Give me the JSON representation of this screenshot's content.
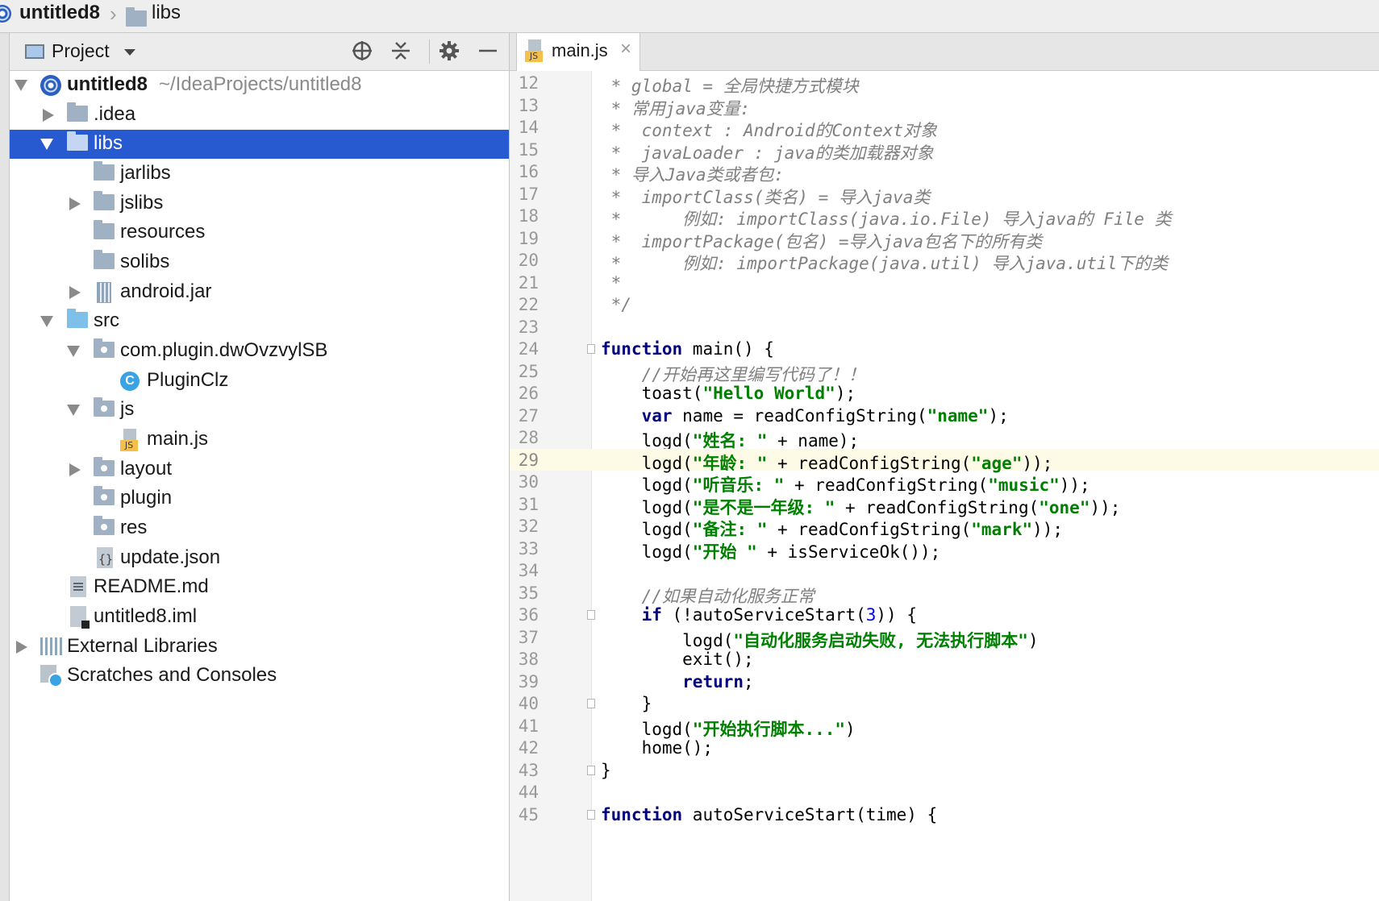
{
  "breadcrumb": {
    "project": "untitled8",
    "folder": "libs"
  },
  "project_panel": {
    "title": "Project",
    "tools": [
      "locate-icon",
      "collapse-icon",
      "gear-icon",
      "minimize-icon"
    ]
  },
  "tree": [
    {
      "label": "untitled8",
      "path": "~/IdeaProjects/untitled8"
    },
    {
      "label": ".idea"
    },
    {
      "label": "libs"
    },
    {
      "label": "jarlibs"
    },
    {
      "label": "jslibs"
    },
    {
      "label": "resources"
    },
    {
      "label": "solibs"
    },
    {
      "label": "android.jar"
    },
    {
      "label": "src"
    },
    {
      "label": "com.plugin.dwOvzvylSB"
    },
    {
      "label": "PluginClz"
    },
    {
      "label": "js"
    },
    {
      "label": "main.js"
    },
    {
      "label": "layout"
    },
    {
      "label": "plugin"
    },
    {
      "label": "res"
    },
    {
      "label": "update.json"
    },
    {
      "label": "README.md"
    },
    {
      "label": "untitled8.iml"
    },
    {
      "label": "External Libraries"
    },
    {
      "label": "Scratches and Consoles"
    }
  ],
  "editor": {
    "tab_label": "main.js",
    "current_line": "29",
    "lines": [
      {
        "n": "12",
        "t": [
          [
            "c",
            " * global = 全局快捷方式模块"
          ]
        ]
      },
      {
        "n": "13",
        "t": [
          [
            "c",
            " * 常用java变量:"
          ]
        ]
      },
      {
        "n": "14",
        "t": [
          [
            "c",
            " *  context : Android的Context对象"
          ]
        ]
      },
      {
        "n": "15",
        "t": [
          [
            "c",
            " *  javaLoader : java的类加载器对象"
          ]
        ]
      },
      {
        "n": "16",
        "t": [
          [
            "c",
            " * 导入Java类或者包:"
          ]
        ]
      },
      {
        "n": "17",
        "t": [
          [
            "c",
            " *  importClass(类名) = 导入java类"
          ]
        ]
      },
      {
        "n": "18",
        "t": [
          [
            "c",
            " *      例如: importClass(java.io.File) 导入java的 File 类"
          ]
        ]
      },
      {
        "n": "19",
        "t": [
          [
            "c",
            " *  importPackage(包名) =导入java包名下的所有类"
          ]
        ]
      },
      {
        "n": "20",
        "t": [
          [
            "c",
            " *      例如: importPackage(java.util) 导入java.util下的类"
          ]
        ]
      },
      {
        "n": "21",
        "t": [
          [
            "c",
            " *"
          ]
        ]
      },
      {
        "n": "22",
        "t": [
          [
            "c",
            " */"
          ]
        ]
      },
      {
        "n": "23",
        "t": []
      },
      {
        "n": "24",
        "t": [
          [
            "k",
            "function"
          ],
          [
            "p",
            " main() {"
          ]
        ]
      },
      {
        "n": "25",
        "t": [
          [
            "p",
            "    "
          ],
          [
            "c2",
            "//开始再这里编写代码了！！"
          ]
        ]
      },
      {
        "n": "26",
        "t": [
          [
            "p",
            "    toast("
          ],
          [
            "s",
            "\"Hello World\""
          ],
          [
            "p",
            ");"
          ]
        ]
      },
      {
        "n": "27",
        "t": [
          [
            "p",
            "    "
          ],
          [
            "k",
            "var"
          ],
          [
            "p",
            " name = readConfigString("
          ],
          [
            "s",
            "\"name\""
          ],
          [
            "p",
            ");"
          ]
        ]
      },
      {
        "n": "28",
        "t": [
          [
            "p",
            "    logd("
          ],
          [
            "s",
            "\"姓名: \""
          ],
          [
            "p",
            " + name);"
          ]
        ]
      },
      {
        "n": "29",
        "t": [
          [
            "p",
            "    logd("
          ],
          [
            "s",
            "\"年龄: \""
          ],
          [
            "p",
            " + readConfigString("
          ],
          [
            "s",
            "\"age\""
          ],
          [
            "p",
            "));"
          ]
        ]
      },
      {
        "n": "30",
        "t": [
          [
            "p",
            "    logd("
          ],
          [
            "s",
            "\"听音乐: \""
          ],
          [
            "p",
            " + readConfigString("
          ],
          [
            "s",
            "\"music\""
          ],
          [
            "p",
            "));"
          ]
        ]
      },
      {
        "n": "31",
        "t": [
          [
            "p",
            "    logd("
          ],
          [
            "s",
            "\"是不是一年级: \""
          ],
          [
            "p",
            " + readConfigString("
          ],
          [
            "s",
            "\"one\""
          ],
          [
            "p",
            "));"
          ]
        ]
      },
      {
        "n": "32",
        "t": [
          [
            "p",
            "    logd("
          ],
          [
            "s",
            "\"备注: \""
          ],
          [
            "p",
            " + readConfigString("
          ],
          [
            "s",
            "\"mark\""
          ],
          [
            "p",
            "));"
          ]
        ]
      },
      {
        "n": "33",
        "t": [
          [
            "p",
            "    logd("
          ],
          [
            "s",
            "\"开始 \""
          ],
          [
            "p",
            " + isServiceOk());"
          ]
        ]
      },
      {
        "n": "34",
        "t": []
      },
      {
        "n": "35",
        "t": [
          [
            "p",
            "    "
          ],
          [
            "c2",
            "//如果自动化服务正常"
          ]
        ]
      },
      {
        "n": "36",
        "t": [
          [
            "p",
            "    "
          ],
          [
            "k",
            "if"
          ],
          [
            "p",
            " (!autoServiceStart("
          ],
          [
            "num",
            "3"
          ],
          [
            "p",
            ")) {"
          ]
        ]
      },
      {
        "n": "37",
        "t": [
          [
            "p",
            "        logd("
          ],
          [
            "s",
            "\"自动化服务启动失败, 无法执行脚本\""
          ],
          [
            "p",
            ")"
          ]
        ]
      },
      {
        "n": "38",
        "t": [
          [
            "p",
            "        exit();"
          ]
        ]
      },
      {
        "n": "39",
        "t": [
          [
            "p",
            "        "
          ],
          [
            "k",
            "return"
          ],
          [
            "p",
            ";"
          ]
        ]
      },
      {
        "n": "40",
        "t": [
          [
            "p",
            "    }"
          ]
        ]
      },
      {
        "n": "41",
        "t": [
          [
            "p",
            "    logd("
          ],
          [
            "s",
            "\"开始执行脚本...\""
          ],
          [
            "p",
            ")"
          ]
        ]
      },
      {
        "n": "42",
        "t": [
          [
            "p",
            "    home();"
          ]
        ]
      },
      {
        "n": "43",
        "t": [
          [
            "p",
            "}"
          ]
        ]
      },
      {
        "n": "44",
        "t": []
      },
      {
        "n": "45",
        "t": [
          [
            "k",
            "function"
          ],
          [
            "p",
            " autoServiceStart(time) {"
          ]
        ]
      }
    ]
  },
  "colors": {
    "selection": "#2759d1",
    "keyword": "#000080",
    "string": "#008000",
    "comment": "#808080",
    "current_line": "#fdfbe6"
  }
}
